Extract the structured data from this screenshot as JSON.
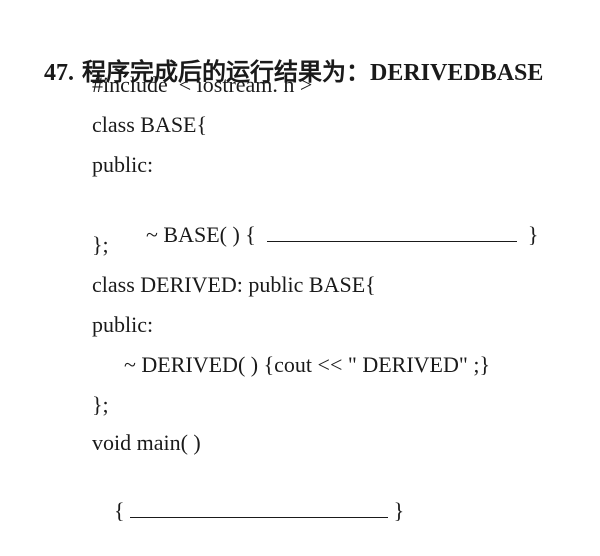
{
  "question": {
    "number": "47.",
    "prompt": "程序完成后的运行结果为：DERIVEDBASE"
  },
  "code": {
    "line1": "#include  < iostream. h >",
    "line2": "class BASE{",
    "line3": "public:",
    "line4_pre": "~ BASE( ) {  ",
    "line4_post": "  }",
    "line5": "};",
    "line6": "class DERIVED: public BASE{",
    "line7": "public:",
    "line8": "~ DERIVED( ) {cout << \" DERIVED\" ;}",
    "line9": "};",
    "line10": "void main( )",
    "line11_pre": "{ ",
    "line11_post": " }"
  }
}
